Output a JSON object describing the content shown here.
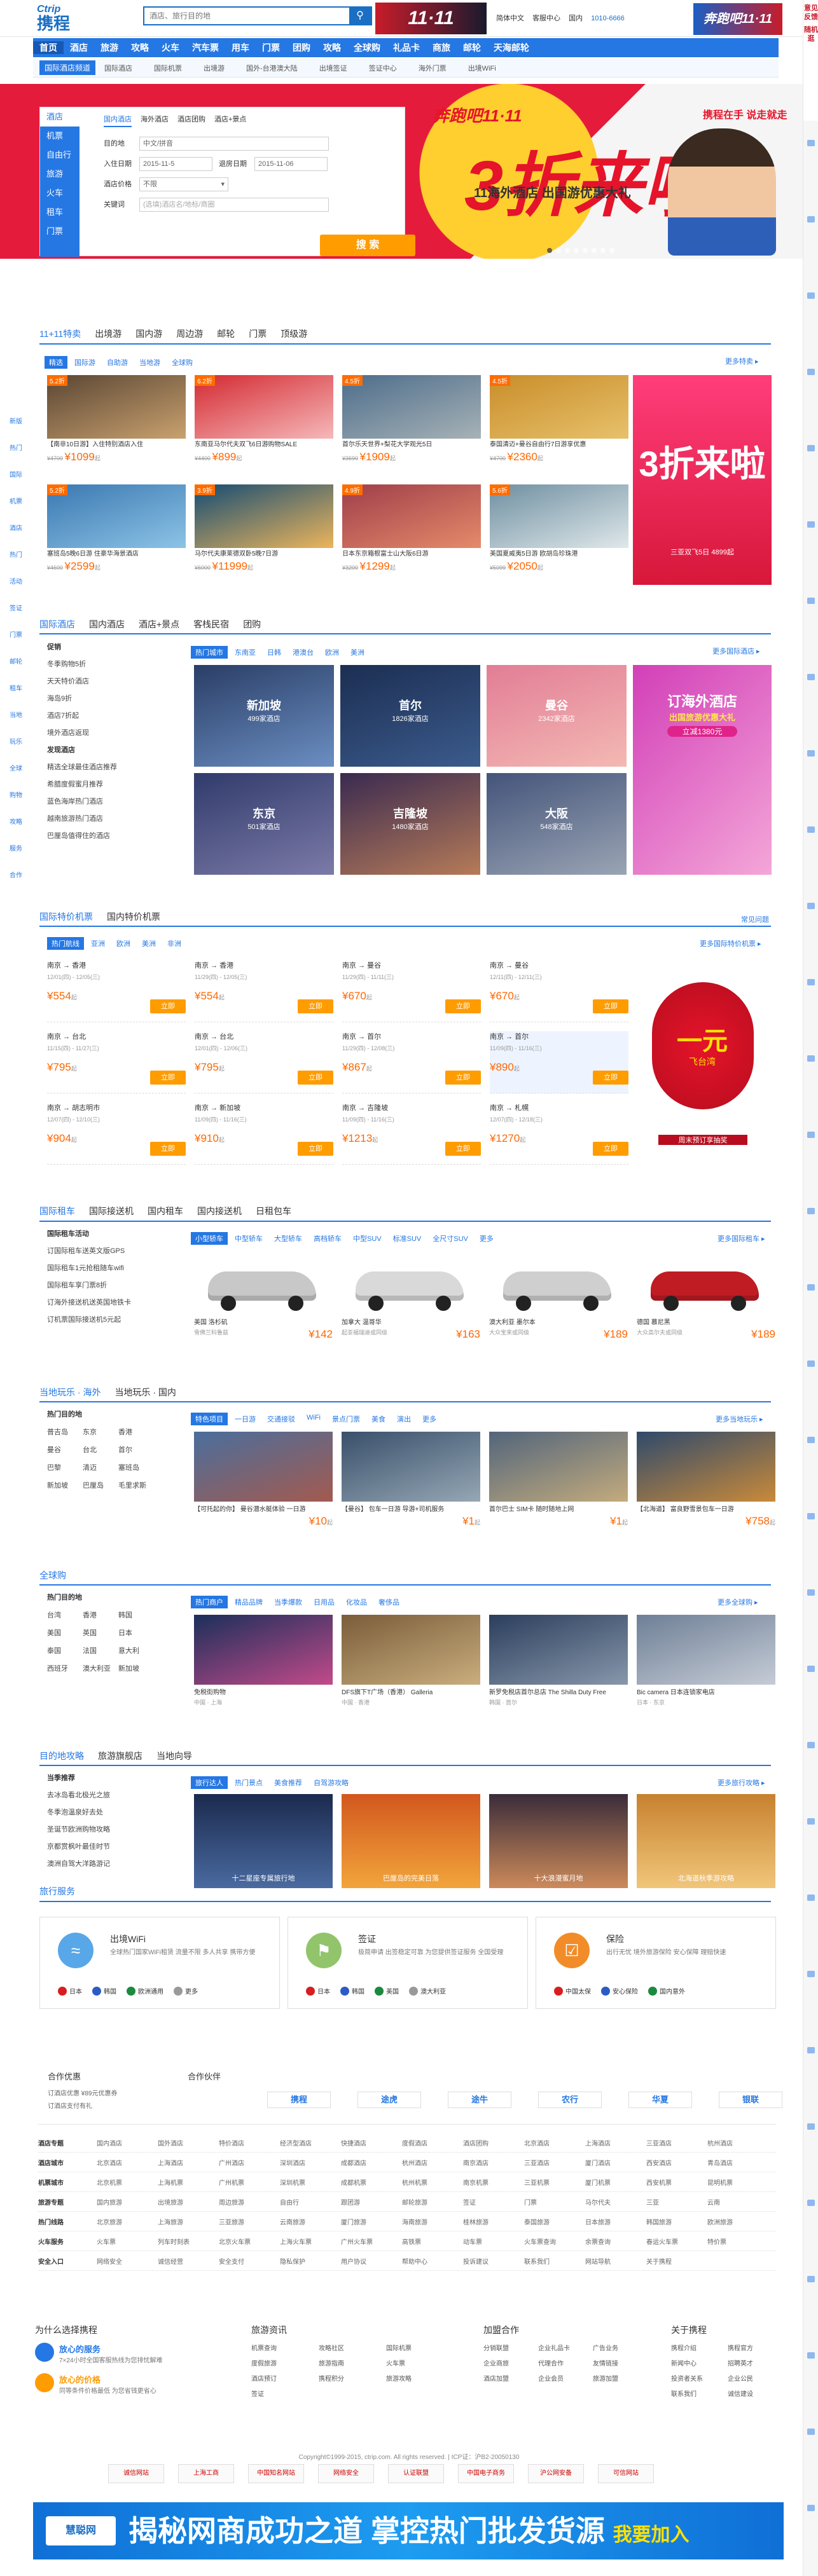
{
  "header": {
    "logo_en": "Ctrip",
    "logo_cn": "携程",
    "search_placeholder": "酒店、旅行目的地",
    "links": [
      "简体中文",
      "客服中心",
      "国内",
      "1010-6666"
    ],
    "ad": "11·11",
    "right_ad": "奔跑吧11·11"
  },
  "nav": {
    "items": [
      "首页",
      "酒店",
      "旅游",
      "攻略",
      "火车",
      "汽车票",
      "用车",
      "门票",
      "团购",
      "攻略",
      "全球购",
      "礼品卡",
      "商旅",
      "邮轮",
      "天海邮轮"
    ],
    "active": 0
  },
  "subnav": {
    "first": "国际酒店频道",
    "items": [
      "国际酒店",
      "国际机票",
      "出境游",
      "国外-台港澳大陆",
      "出境签证",
      "签证中心",
      "海外门票",
      "出境WiFi"
    ]
  },
  "hero": {
    "badge": "奔跑吧11·11",
    "big": "3折来啦",
    "sub": "11海外酒店 出国游优惠大礼",
    "slogan": "携程在手 说走就走"
  },
  "booking": {
    "side": [
      "酒店",
      "机票",
      "自由行",
      "旅游",
      "火车",
      "租车",
      "门票"
    ],
    "tabs": [
      "国内酒店",
      "海外酒店",
      "酒店团购",
      "酒店+景点"
    ],
    "city_label": "目的地",
    "city_value": "中文/拼音",
    "checkin_label": "入住日期",
    "checkin": "2015-11-5",
    "checkout_label": "退房日期",
    "checkout": "2015-11-06",
    "price_label": "酒店价格",
    "price": "不限",
    "kw_label": "关键词",
    "kw_placeholder": "(选填)酒店名/地标/商圈",
    "search": "搜 索"
  },
  "s1": {
    "tabs": [
      "11+11特卖",
      "出境游",
      "国内游",
      "周边游",
      "邮轮",
      "门票",
      "顶级游"
    ],
    "chips": [
      "精选",
      "国际游",
      "自助游",
      "当地游",
      "全球购"
    ],
    "more": "更多特卖 ▸",
    "cards": [
      {
        "tag": "5.2折",
        "cap": "【南非10日游】入住特别酒店入住",
        "old": "¥4700",
        "price": "¥1099",
        "unit": "起",
        "c1": "#5a4634",
        "c2": "#c9a16e"
      },
      {
        "tag": "6.2折",
        "cap": "东南亚马尔代夫双飞6日游购物SALE",
        "old": "¥4400",
        "price": "¥899",
        "unit": "起",
        "c1": "#d32a31",
        "c2": "#f6b8ba"
      },
      {
        "tag": "4.5折",
        "cap": "首尔乐天世界+梨花大学观光5日",
        "old": "¥3690",
        "price": "¥1909",
        "unit": "起",
        "c1": "#4d6d8b",
        "c2": "#a7b2b6"
      },
      {
        "tag": "4.5折",
        "cap": "泰国清迈+曼谷自由行7日游享优惠",
        "old": "¥4700",
        "price": "¥2360",
        "unit": "起",
        "c1": "#c98d2a",
        "c2": "#e7c16b"
      },
      {
        "tag": "5.2折",
        "cap": "塞班岛5晚6日游 住豪华海景酒店",
        "old": "¥4600",
        "price": "¥2599",
        "unit": "起",
        "c1": "#3b78b1",
        "c2": "#8cc3e6"
      },
      {
        "tag": "3.9折",
        "cap": "马尔代夫康莱德双卧5晚7日游",
        "old": "¥6000",
        "price": "¥11999",
        "unit": "起",
        "c1": "#154c73",
        "c2": "#ecb55b"
      },
      {
        "tag": "4.9折",
        "cap": "日本东京箱根富士山大阪6日游",
        "old": "¥3200",
        "price": "¥1299",
        "unit": "起",
        "c1": "#9f3e4a",
        "c2": "#e58b6a"
      },
      {
        "tag": "5.6折",
        "cap": "美国夏威夷5日游 欧胡岛珍珠港",
        "old": "¥5099",
        "price": "¥2050",
        "unit": "起",
        "c1": "#6f8fa1",
        "c2": "#dfe8ea"
      }
    ],
    "promo": {
      "t": "3折来啦",
      "s": "三亚双飞5日 4899起"
    }
  },
  "s2": {
    "tabs": [
      "国际酒店",
      "国内酒店",
      "酒店+景点",
      "客栈民宿",
      "团购"
    ],
    "chips": [
      "热门城市",
      "东南亚",
      "日韩",
      "港澳台",
      "欧洲",
      "美洲"
    ],
    "more": "更多国际酒店 ▸",
    "left": {
      "h1": "促销",
      "l1": [
        "冬季购物5折",
        "天天特价酒店",
        "海岛9折",
        "酒店7折起",
        "境外酒店返现"
      ],
      "h2": "发现酒店",
      "l2": [
        "精选全球最佳酒店推荐",
        "希腊度假蜜月推荐",
        "蓝色海岸热门酒店",
        "越南旅游热门酒店",
        "巴厘岛值得住的酒店"
      ]
    },
    "cities": [
      {
        "name": "新加坡",
        "count": "499家酒店",
        "c1": "#2a3e66",
        "c2": "#6b8ec2"
      },
      {
        "name": "首尔",
        "count": "1826家酒店",
        "c1": "#1c2e52",
        "c2": "#3b5b8c"
      },
      {
        "name": "曼谷",
        "count": "2342家酒店",
        "c1": "#e27d96",
        "c2": "#f3b9b3"
      },
      {
        "name": "东京",
        "count": "501家酒店",
        "c1": "#303b6b",
        "c2": "#7c7aa8"
      },
      {
        "name": "吉隆坡",
        "count": "1480家酒店",
        "c1": "#3a2a50",
        "c2": "#b67b58"
      },
      {
        "name": "大阪",
        "count": "548家酒店",
        "c1": "#44547a",
        "c2": "#9aa4b4"
      }
    ],
    "promo": {
      "t": "订海外酒店",
      "s": "出国旅游优惠大礼",
      "b": "立减1380元"
    }
  },
  "s3": {
    "tabs": [
      "国际特价机票",
      "国内特价机票"
    ],
    "chips": [
      "热门航线",
      "亚洲",
      "欧洲",
      "美洲",
      "非洲"
    ],
    "more": "更多国际特价机票 ▸",
    "help": "常见问题",
    "flights": [
      {
        "route": "南京 → 香港",
        "date": "12/01(四) - 12/05(三)",
        "price": "¥554",
        "unit": "起"
      },
      {
        "route": "南京 → 香港",
        "date": "11/29(四) - 12/05(三)",
        "price": "¥554",
        "unit": "起"
      },
      {
        "route": "南京 → 曼谷",
        "date": "11/29(四) - 11/11(三)",
        "price": "¥670",
        "unit": "起"
      },
      {
        "route": "南京 → 曼谷",
        "date": "12/11(四) - 12/11(三)",
        "price": "¥670",
        "unit": "起"
      },
      {
        "route": "南京 → 台北",
        "date": "11/15(四) - 11/27(三)",
        "price": "¥795",
        "unit": "起"
      },
      {
        "route": "南京 → 台北",
        "date": "12/01(四) - 12/06(三)",
        "price": "¥795",
        "unit": "起"
      },
      {
        "route": "南京 → 首尔",
        "date": "11/29(四) - 12/08(三)",
        "price": "¥867",
        "unit": "起"
      },
      {
        "route": "南京 → 首尔",
        "date": "11/09(四) - 11/16(三)",
        "price": "¥890",
        "unit": "起"
      },
      {
        "route": "南京 → 胡志明市",
        "date": "12/07(四) - 12/10(三)",
        "price": "¥904",
        "unit": "起"
      },
      {
        "route": "南京 → 新加坡",
        "date": "11/09(四) - 11/16(三)",
        "price": "¥910",
        "unit": "起"
      },
      {
        "route": "南京 → 吉隆坡",
        "date": "11/09(四) - 11/16(三)",
        "price": "¥1213",
        "unit": "起"
      },
      {
        "route": "南京 → 札幌",
        "date": "12/07(四) - 12/18(三)",
        "price": "¥1270",
        "unit": "起"
      }
    ],
    "book": "立即",
    "promo": {
      "t": "一元",
      "s": "飞台湾",
      "b": "周末预订享抽奖"
    }
  },
  "s4": {
    "tabs": [
      "国际租车",
      "国际接送机",
      "国内租车",
      "国内接送机",
      "日租包车"
    ],
    "chips": [
      "小型轿车",
      "中型轿车",
      "大型轿车",
      "高档轿车",
      "中型SUV",
      "标准SUV",
      "全尺寸SUV",
      "更多"
    ],
    "more": "更多国际租车 ▸",
    "left": {
      "h": "国际租车活动",
      "l": [
        "订国际租车送英文版GPS",
        "国际租车1元抢租随车wifi",
        "国际租车享门票8折",
        "订海外接送机送英国地铁卡",
        "订机票国际接送机5元起"
      ]
    },
    "cars": [
      {
        "name": "美国 洛杉矶",
        "sub": "雪佛兰科鲁兹",
        "price": "¥142",
        "unit": "起",
        "color": "#c8c8c8"
      },
      {
        "name": "加拿大 温哥华",
        "sub": "起亚福瑞迪或同级",
        "price": "¥163",
        "unit": "起",
        "color": "#d9d9d9"
      },
      {
        "name": "澳大利亚 墨尔本",
        "sub": "大众宝来或同级",
        "price": "¥189",
        "unit": "起",
        "color": "#cfcfcf"
      },
      {
        "name": "德国 慕尼黑",
        "sub": "大众高尔夫或同级",
        "price": "¥189",
        "unit": "起",
        "color": "#c01c24"
      }
    ]
  },
  "s5": {
    "tabs": [
      "当地玩乐 · 海外",
      "当地玩乐 · 国内"
    ],
    "chips": [
      "特色项目",
      "一日游",
      "交通接驳",
      "WiFi",
      "景点门票",
      "美食",
      "演出",
      "更多"
    ],
    "more": "更多当地玩乐 ▸",
    "left": {
      "h": "热门目的地",
      "places": [
        "普吉岛",
        "东京",
        "香港",
        "曼谷",
        "台北",
        "首尔",
        "巴黎",
        "清迈",
        "塞班岛",
        "新加坡",
        "巴厘岛",
        "毛里求斯"
      ]
    },
    "items": [
      {
        "cap": "【可托起的你】 曼谷潜水艇体验 一日游",
        "price": "¥10",
        "unit": "起",
        "c1": "#4a6e9c",
        "c2": "#a35a4f"
      },
      {
        "cap": "【曼谷】 包车一日游 导游+司机服务",
        "price": "¥1",
        "unit": "起",
        "c1": "#39506b",
        "c2": "#96a7b4"
      },
      {
        "cap": "首尔巴士 SIM卡 随时随地上网",
        "price": "¥1",
        "unit": "起",
        "c1": "#52657b",
        "c2": "#c3ab7d"
      },
      {
        "cap": "【北海道】 富良野雪景包车一日游",
        "price": "¥758",
        "unit": "起",
        "c1": "#2f4a6b",
        "c2": "#c98a3a"
      }
    ]
  },
  "s6": {
    "tabs": [
      "全球购"
    ],
    "chips": [
      "热门商户",
      "精品品牌",
      "当季爆款",
      "日用品",
      "化妆品",
      "奢侈品"
    ],
    "more": "更多全球购 ▸",
    "left": {
      "h": "热门目的地",
      "places": [
        "台湾",
        "香港",
        "韩国",
        "美国",
        "英国",
        "日本",
        "泰国",
        "法国",
        "意大利",
        "西班牙",
        "澳大利亚",
        "新加坡"
      ]
    },
    "items": [
      {
        "cap": "免税街购物",
        "sub": "中国 · 上海",
        "c1": "#1b2f5a",
        "c2": "#c24a8a"
      },
      {
        "cap": "DFS旗下T广场（香港） Galleria",
        "sub": "中国 · 香港",
        "c1": "#7a5d3a",
        "c2": "#c9ae7e"
      },
      {
        "cap": "新罗免税店首尔总店 The Shilla Duty Free",
        "sub": "韩国 · 首尔",
        "c1": "#2b3e5c",
        "c2": "#8797ab"
      },
      {
        "cap": "Bic camera 日本连锁家电店",
        "sub": "日本 · 东京",
        "c1": "#6e7f96",
        "c2": "#c6ccd6"
      }
    ]
  },
  "s7": {
    "tabs": [
      "目的地攻略",
      "旅游旗舰店",
      "当地向导"
    ],
    "chips": [
      "旅行达人",
      "热门景点",
      "美食推荐",
      "自驾游攻略"
    ],
    "more": "更多旅行攻略 ▸",
    "left": {
      "h": "当季推荐",
      "l": [
        "去冰岛看北极光之旅",
        "冬季泡温泉好去处",
        "圣诞节欧洲购物攻略",
        "京都赏枫叶最佳时节",
        "澳洲自驾大洋路游记"
      ]
    },
    "items": [
      {
        "cap": "十二星座专属旅行地",
        "c1": "#1b2a4e",
        "c2": "#4a6aa0"
      },
      {
        "cap": "巴厘岛的完美日落",
        "c1": "#d2571e",
        "c2": "#f2a53b"
      },
      {
        "cap": "十大浪漫蜜月地",
        "c1": "#3a2c3a",
        "c2": "#cc8a5a"
      },
      {
        "cap": "北海道秋季游攻略",
        "c1": "#c7812f",
        "c2": "#f1c67a"
      }
    ]
  },
  "s8": {
    "tabs": [
      "旅行服务"
    ],
    "boxes": [
      {
        "t": "出境WiFi",
        "d": "全球热门国家WiFi租赁 流量不限 多人共享 携带方便",
        "flags": [
          "日本",
          "韩国",
          "欧洲通用",
          "更多"
        ],
        "color": "#58a7e8"
      },
      {
        "t": "签证",
        "d": "极简申请 出签稳定可靠 为您提供签证服务 全国受理",
        "flags": [
          "日本",
          "韩国",
          "美国",
          "澳大利亚"
        ],
        "color": "#91c46b"
      },
      {
        "t": "保险",
        "d": "出行无忧 境外旅游保险 安心保障 理赔快速",
        "flags": [
          "中国太保",
          "安心保险",
          "国内意外"
        ],
        "color": "#f28c29"
      }
    ]
  },
  "partners": {
    "h1": "合作优惠",
    "h2": "合作伙伴",
    "text1": "订酒店优惠 ¥89元优惠券",
    "text2": "订酒店支付有礼",
    "names": [
      "携程",
      "途虎",
      "途牛",
      "农行",
      "华夏",
      "银联"
    ]
  },
  "links": {
    "rows": [
      {
        "h": "酒店专题",
        "c": [
          "国内酒店",
          "国外酒店",
          "特价酒店",
          "经济型酒店",
          "快捷酒店",
          "度假酒店",
          "酒店团购",
          "北京酒店",
          "上海酒店",
          "三亚酒店",
          "杭州酒店"
        ]
      },
      {
        "h": "酒店城市",
        "c": [
          "北京酒店",
          "上海酒店",
          "广州酒店",
          "深圳酒店",
          "成都酒店",
          "杭州酒店",
          "南京酒店",
          "三亚酒店",
          "厦门酒店",
          "西安酒店",
          "青岛酒店"
        ]
      },
      {
        "h": "机票城市",
        "c": [
          "北京机票",
          "上海机票",
          "广州机票",
          "深圳机票",
          "成都机票",
          "杭州机票",
          "南京机票",
          "三亚机票",
          "厦门机票",
          "西安机票",
          "昆明机票"
        ]
      },
      {
        "h": "旅游专题",
        "c": [
          "国内旅游",
          "出境旅游",
          "周边旅游",
          "自由行",
          "跟团游",
          "邮轮旅游",
          "签证",
          "门票",
          "马尔代夫",
          "三亚",
          "云南"
        ]
      },
      {
        "h": "热门线路",
        "c": [
          "北京旅游",
          "上海旅游",
          "三亚旅游",
          "云南旅游",
          "厦门旅游",
          "海南旅游",
          "桂林旅游",
          "泰国旅游",
          "日本旅游",
          "韩国旅游",
          "欧洲旅游"
        ]
      },
      {
        "h": "火车服务",
        "c": [
          "火车票",
          "列车时刻表",
          "北京火车票",
          "上海火车票",
          "广州火车票",
          "高铁票",
          "动车票",
          "火车票查询",
          "余票查询",
          "春运火车票",
          "特价票"
        ]
      },
      {
        "h": "安全入口",
        "c": [
          "网络安全",
          "诚信经营",
          "安全支付",
          "隐私保护",
          "用户协议",
          "帮助中心",
          "投诉建议",
          "联系我们",
          "网站导航",
          "关于携程"
        ]
      }
    ]
  },
  "footer": {
    "why": "为什么选择携程",
    "w1t": "放心的服务",
    "w1d": "7×24小时全国客服热线为您排忧解难",
    "w2t": "放心的价格",
    "w2d": "同等条件价格最低 为您省钱更省心",
    "c2": "旅游资讯",
    "c2l": [
      "机票查询",
      "攻略社区",
      "国际机票",
      "度假旅游",
      "旅游指南",
      "火车票",
      "酒店预订",
      "携程积分",
      "旅游攻略",
      "签证"
    ],
    "c3": "加盟合作",
    "c3l": [
      "分销联盟",
      "企业礼品卡",
      "广告业务",
      "企业商旅",
      "代理合作",
      "友情链接",
      "酒店加盟",
      "企业会员",
      "旅游加盟"
    ],
    "c4": "关于携程",
    "c4l": [
      "携程介绍",
      "携程官方",
      "新闻中心",
      "招聘英才",
      "投资者关系",
      "企业公民",
      "联系我们",
      "诚信建设"
    ],
    "copy": "Copyright©1999-2015, ctrip.com. All rights reserved. | ICP证：沪B2-20050130",
    "badges": [
      "诚信网站",
      "上海工商",
      "中国知名网站",
      "网络安全",
      "认证联盟",
      "中国电子商务",
      "沪公网安备",
      "可信网站"
    ]
  },
  "bottom_ad": {
    "logo": "慧聪网",
    "t": "揭秘网商成功之道 掌控热门批发货源",
    "y": "我要加入"
  },
  "leftbar": [
    "新版",
    "热门",
    "国际",
    "机票",
    "酒店",
    "热门",
    "活动",
    "签证",
    "门票",
    "邮轮",
    "租车",
    "当地",
    "玩乐",
    "全球",
    "购物",
    "攻略",
    "服务",
    "合作"
  ],
  "rightbar": {
    "labels": [
      "意见反馈",
      "随机逛"
    ]
  }
}
